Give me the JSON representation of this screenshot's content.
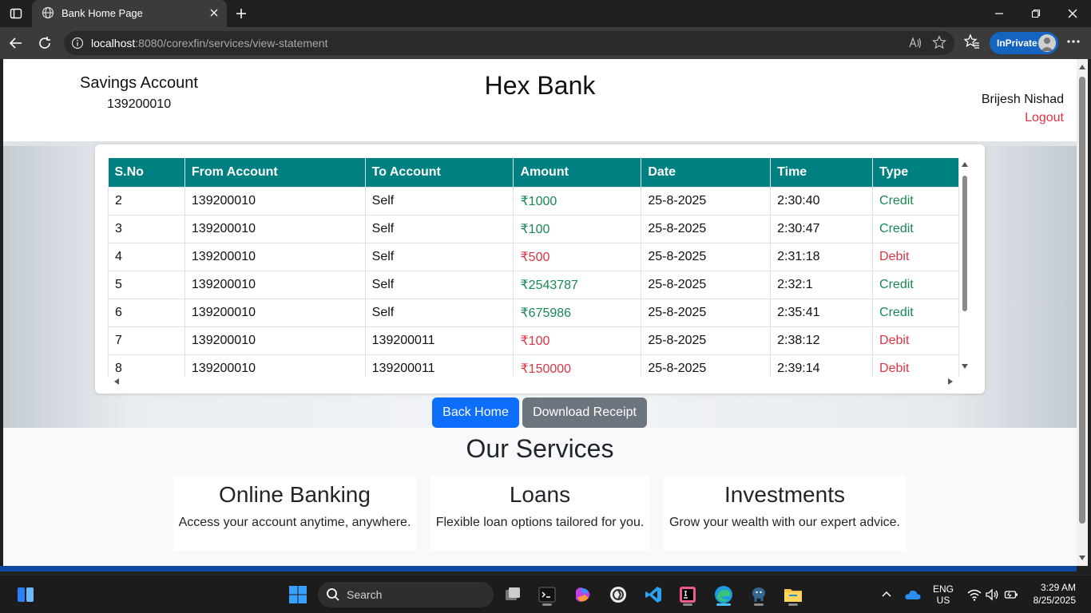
{
  "browser": {
    "tab_title": "Bank Home Page",
    "url_host": "localhost",
    "url_rest": ":8080/corexfin/services/view-statement",
    "inprivate_label": "InPrivate"
  },
  "header": {
    "account_type": "Savings Account",
    "account_number": "139200010",
    "bank_name": "Hex Bank",
    "user_name": "Brijesh Nishad",
    "logout_label": "Logout"
  },
  "statement": {
    "columns": [
      "S.No",
      "From Account",
      "To Account",
      "Amount",
      "Date",
      "Time",
      "Type"
    ],
    "rows": [
      {
        "sno": "2",
        "from": "139200010",
        "to": "Self",
        "amount": "₹1000",
        "date": "25-8-2025",
        "time": "2:30:40",
        "type": "Credit"
      },
      {
        "sno": "3",
        "from": "139200010",
        "to": "Self",
        "amount": "₹100",
        "date": "25-8-2025",
        "time": "2:30:47",
        "type": "Credit"
      },
      {
        "sno": "4",
        "from": "139200010",
        "to": "Self",
        "amount": "₹500",
        "date": "25-8-2025",
        "time": "2:31:18",
        "type": "Debit"
      },
      {
        "sno": "5",
        "from": "139200010",
        "to": "Self",
        "amount": "₹2543787",
        "date": "25-8-2025",
        "time": "2:32:1",
        "type": "Credit"
      },
      {
        "sno": "6",
        "from": "139200010",
        "to": "Self",
        "amount": "₹675986",
        "date": "25-8-2025",
        "time": "2:35:41",
        "type": "Credit"
      },
      {
        "sno": "7",
        "from": "139200010",
        "to": "139200011",
        "amount": "₹100",
        "date": "25-8-2025",
        "time": "2:38:12",
        "type": "Debit"
      },
      {
        "sno": "8",
        "from": "139200010",
        "to": "139200011",
        "amount": "₹150000",
        "date": "25-8-2025",
        "time": "2:39:14",
        "type": "Debit"
      }
    ]
  },
  "actions": {
    "back_home": "Back Home",
    "download_receipt": "Download Receipt"
  },
  "services": {
    "title": "Our Services",
    "items": [
      {
        "title": "Online Banking",
        "desc": "Access your account anytime, anywhere."
      },
      {
        "title": "Loans",
        "desc": "Flexible loan options tailored for you."
      },
      {
        "title": "Investments",
        "desc": "Grow your wealth with our expert advice."
      }
    ]
  },
  "taskbar": {
    "search_label": "Search",
    "lang": "ENG",
    "region": "US",
    "time": "3:29 AM",
    "date": "8/25/2025"
  },
  "colors": {
    "table_header": "#008080",
    "credit": "#198754",
    "debit": "#dc3545",
    "primary_button": "#0d6efd",
    "secondary_button": "#6c757d",
    "inprivate": "#1565c0"
  }
}
